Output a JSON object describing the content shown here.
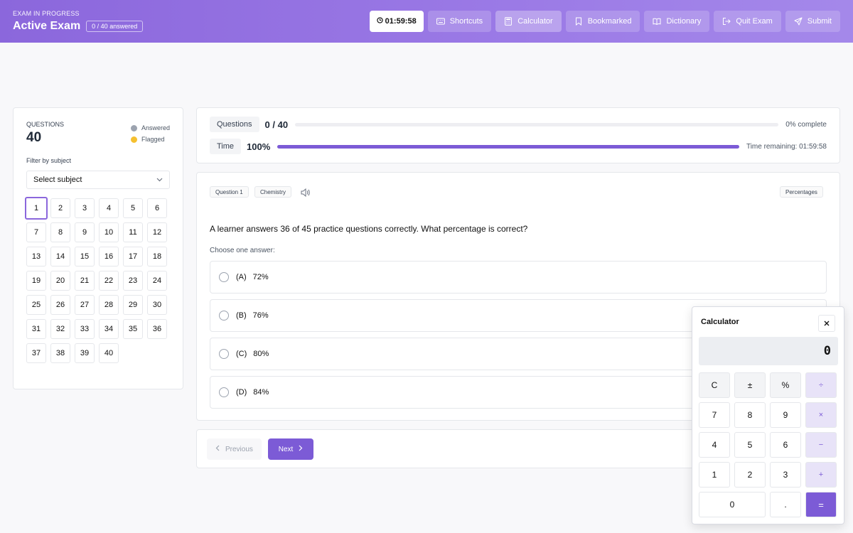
{
  "header": {
    "status_label": "EXAM IN PROGRESS",
    "title": "Active Exam",
    "answered_badge": "0 / 40 answered",
    "timer": "01:59:58",
    "buttons": [
      {
        "label": "Shortcuts",
        "icon": "keyboard-icon"
      },
      {
        "label": "Calculator",
        "icon": "calculator-icon"
      },
      {
        "label": "Bookmarked",
        "icon": "bookmark-icon"
      },
      {
        "label": "Dictionary",
        "icon": "book-icon"
      },
      {
        "label": "Quit Exam",
        "icon": "logout-icon"
      },
      {
        "label": "Submit",
        "icon": "send-icon"
      }
    ]
  },
  "sidebar": {
    "questions_label": "QUESTIONS",
    "questions_count": "40",
    "legend": [
      {
        "label": "Answered",
        "color": "#9ca3af"
      },
      {
        "label": "Flagged",
        "color": "#f5c030"
      }
    ],
    "filter_label": "Filter by subject",
    "filter_value": "Select subject",
    "current_question": 1,
    "question_numbers": [
      "1",
      "2",
      "3",
      "4",
      "5",
      "6",
      "7",
      "8",
      "9",
      "10",
      "11",
      "12",
      "13",
      "14",
      "15",
      "16",
      "17",
      "18",
      "19",
      "20",
      "21",
      "22",
      "23",
      "24",
      "25",
      "26",
      "27",
      "28",
      "29",
      "30",
      "31",
      "32",
      "33",
      "34",
      "35",
      "36",
      "37",
      "38",
      "39",
      "40"
    ]
  },
  "progress": {
    "questions_label": "Questions",
    "questions_value": "0 / 40",
    "questions_fraction": 0,
    "questions_right": "0% complete",
    "time_label": "Time",
    "time_value": "100%",
    "time_fraction": 1.0,
    "time_right": "Time remaining: 01:59:58",
    "accent_color": "#7c5bd6"
  },
  "question": {
    "number_chip": "Question 1",
    "subject_chip": "Chemistry",
    "topic_chip": "Percentages",
    "text": "A learner answers 36 of 45 practice questions correctly. What percentage is correct?",
    "prompt": "Choose one answer:",
    "options": [
      {
        "letter": "(A)",
        "text": "72%"
      },
      {
        "letter": "(B)",
        "text": "76%"
      },
      {
        "letter": "(C)",
        "text": "80%"
      },
      {
        "letter": "(D)",
        "text": "84%"
      }
    ]
  },
  "nav": {
    "previous_label": "Previous",
    "next_label": "Next"
  },
  "calculator": {
    "title": "Calculator",
    "display": "0",
    "keys": [
      {
        "label": "C",
        "kind": "fn",
        "name": "calc-key-clear"
      },
      {
        "label": "±",
        "kind": "fn",
        "name": "calc-key-sign"
      },
      {
        "label": "%",
        "kind": "fn",
        "name": "calc-key-percent"
      },
      {
        "label": "÷",
        "kind": "op",
        "name": "calc-key-divide"
      },
      {
        "label": "7",
        "kind": "num",
        "name": "calc-key-7"
      },
      {
        "label": "8",
        "kind": "num",
        "name": "calc-key-8"
      },
      {
        "label": "9",
        "kind": "num",
        "name": "calc-key-9"
      },
      {
        "label": "×",
        "kind": "op",
        "name": "calc-key-multiply"
      },
      {
        "label": "4",
        "kind": "num",
        "name": "calc-key-4"
      },
      {
        "label": "5",
        "kind": "num",
        "name": "calc-key-5"
      },
      {
        "label": "6",
        "kind": "num",
        "name": "calc-key-6"
      },
      {
        "label": "−",
        "kind": "op",
        "name": "calc-key-subtract"
      },
      {
        "label": "1",
        "kind": "num",
        "name": "calc-key-1"
      },
      {
        "label": "2",
        "kind": "num",
        "name": "calc-key-2"
      },
      {
        "label": "3",
        "kind": "num",
        "name": "calc-key-3"
      },
      {
        "label": "+",
        "kind": "op",
        "name": "calc-key-add"
      },
      {
        "label": "0",
        "kind": "num wide",
        "name": "calc-key-0"
      },
      {
        "label": ".",
        "kind": "num",
        "name": "calc-key-decimal"
      },
      {
        "label": "=",
        "kind": "eq",
        "name": "calc-key-equals"
      }
    ]
  }
}
